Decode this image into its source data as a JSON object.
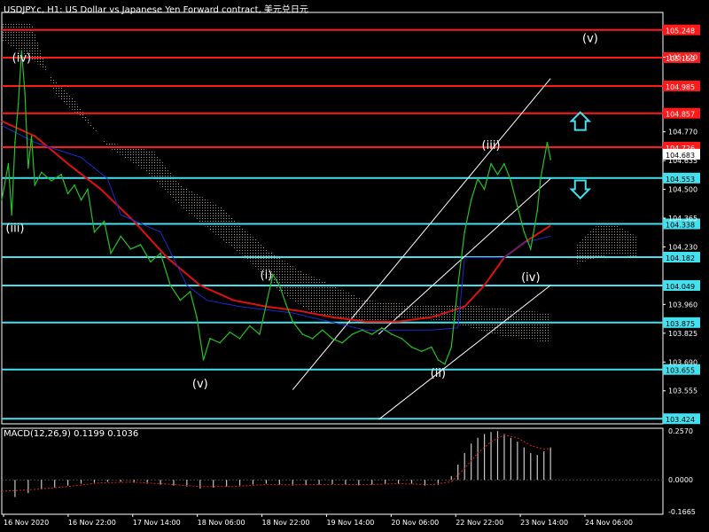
{
  "header": {
    "title": "USDJPY.c, H1:  US Dollar vs Japanese Yen Forward contract, 美元兑日元"
  },
  "macd_header": {
    "label": "MACD(12,26,9) 0.1199 0.1036"
  },
  "colors": {
    "background": "#000000",
    "grid_frame": "#ffffff",
    "red_level": "#ff1a1a",
    "cyan_level": "#44e0ee",
    "price_line": "#22c422",
    "ma_red": "#e01010",
    "ma_blue": "#1a2bd0",
    "cloud_dots": "#d8d0cc",
    "channel": "#ffffff",
    "arrow": "#44e0ee",
    "macd_bars": "#c8c8c8",
    "macd_signal": "#e02020"
  },
  "chart_data": {
    "type": "line",
    "symbol": "USDJPY.c",
    "timeframe": "H1",
    "x_tick_labels": [
      "16 Nov 2020",
      "16 Nov 22:00",
      "17 Nov 14:00",
      "18 Nov 06:00",
      "18 Nov 22:00",
      "19 Nov 14:00",
      "20 Nov 06:00",
      "22 Nov 22:00",
      "23 Nov 14:00",
      "24 Nov 06:00"
    ],
    "ylim": [
      103.4,
      105.33
    ],
    "y_tick_labels": [
      "105.120",
      "104.770",
      "104.635",
      "104.500",
      "104.365",
      "104.230",
      "103.960",
      "103.825",
      "103.690",
      "103.555"
    ],
    "levels": [
      {
        "label": "105.248",
        "value": 105.248,
        "color": "red"
      },
      {
        "label": "105.153",
        "value": 105.118,
        "color": "red"
      },
      {
        "label": "104.985",
        "value": 104.985,
        "color": "red"
      },
      {
        "label": "104.857",
        "value": 104.857,
        "color": "red"
      },
      {
        "label": "104.726",
        "value": 104.698,
        "color": "red"
      },
      {
        "label": "104.553",
        "value": 104.553,
        "color": "cyan"
      },
      {
        "label": "104.338",
        "value": 104.338,
        "color": "cyan"
      },
      {
        "label": "104.182",
        "value": 104.182,
        "color": "cyan"
      },
      {
        "label": "104.049",
        "value": 104.049,
        "color": "cyan"
      },
      {
        "label": "103.875",
        "value": 103.875,
        "color": "cyan"
      },
      {
        "label": "103.655",
        "value": 103.655,
        "color": "cyan"
      },
      {
        "label": "103.424",
        "value": 103.424,
        "color": "cyan"
      }
    ],
    "current_price_label": "104.683",
    "current_price": 104.665,
    "wave_labels": [
      {
        "text": "(iv)",
        "x": 0.03,
        "y": 105.1
      },
      {
        "text": "(iii)",
        "x": 0.02,
        "y": 104.3
      },
      {
        "text": "(v)",
        "x": 0.3,
        "y": 103.57
      },
      {
        "text": "(i)",
        "x": 0.4,
        "y": 104.08
      },
      {
        "text": "(ii)",
        "x": 0.66,
        "y": 103.62
      },
      {
        "text": "(iii)",
        "x": 0.74,
        "y": 104.69
      },
      {
        "text": "(iv)",
        "x": 0.8,
        "y": 104.07
      },
      {
        "text": "(v)",
        "x": 0.89,
        "y": 105.19
      }
    ],
    "arrows": [
      {
        "direction": "up",
        "x": 0.875,
        "y": 104.82
      },
      {
        "direction": "down",
        "x": 0.875,
        "y": 104.5
      }
    ],
    "series": [
      {
        "values": [
          [
            0.0,
            104.45
          ],
          [
            0.01,
            104.62
          ],
          [
            0.015,
            104.38
          ],
          [
            0.02,
            104.72
          ],
          [
            0.025,
            104.9
          ],
          [
            0.03,
            105.15
          ],
          [
            0.035,
            104.95
          ],
          [
            0.04,
            104.6
          ],
          [
            0.045,
            104.75
          ],
          [
            0.05,
            104.52
          ],
          [
            0.06,
            104.58
          ],
          [
            0.075,
            104.54
          ],
          [
            0.09,
            104.57
          ],
          [
            0.1,
            104.48
          ],
          [
            0.11,
            104.52
          ],
          [
            0.12,
            104.45
          ],
          [
            0.13,
            104.5
          ],
          [
            0.14,
            104.3
          ],
          [
            0.155,
            104.35
          ],
          [
            0.165,
            104.2
          ],
          [
            0.18,
            104.28
          ],
          [
            0.195,
            104.22
          ],
          [
            0.21,
            104.24
          ],
          [
            0.225,
            104.16
          ],
          [
            0.24,
            104.2
          ],
          [
            0.255,
            104.05
          ],
          [
            0.27,
            103.98
          ],
          [
            0.285,
            104.02
          ],
          [
            0.295,
            103.9
          ],
          [
            0.305,
            103.7
          ],
          [
            0.315,
            103.8
          ],
          [
            0.33,
            103.78
          ],
          [
            0.345,
            103.83
          ],
          [
            0.36,
            103.8
          ],
          [
            0.375,
            103.86
          ],
          [
            0.39,
            103.82
          ],
          [
            0.4,
            103.96
          ],
          [
            0.41,
            104.1
          ],
          [
            0.42,
            104.05
          ],
          [
            0.43,
            103.96
          ],
          [
            0.44,
            103.88
          ],
          [
            0.455,
            103.82
          ],
          [
            0.47,
            103.8
          ],
          [
            0.485,
            103.84
          ],
          [
            0.5,
            103.8
          ],
          [
            0.515,
            103.78
          ],
          [
            0.53,
            103.82
          ],
          [
            0.545,
            103.84
          ],
          [
            0.56,
            103.82
          ],
          [
            0.575,
            103.85
          ],
          [
            0.59,
            103.82
          ],
          [
            0.605,
            103.8
          ],
          [
            0.62,
            103.76
          ],
          [
            0.635,
            103.74
          ],
          [
            0.65,
            103.76
          ],
          [
            0.66,
            103.7
          ],
          [
            0.67,
            103.68
          ],
          [
            0.68,
            103.76
          ],
          [
            0.69,
            104.05
          ],
          [
            0.7,
            104.3
          ],
          [
            0.71,
            104.45
          ],
          [
            0.72,
            104.55
          ],
          [
            0.73,
            104.5
          ],
          [
            0.74,
            104.62
          ],
          [
            0.75,
            104.57
          ],
          [
            0.76,
            104.62
          ],
          [
            0.77,
            104.54
          ],
          [
            0.78,
            104.42
          ],
          [
            0.79,
            104.3
          ],
          [
            0.8,
            104.22
          ],
          [
            0.81,
            104.4
          ],
          [
            0.815,
            104.55
          ],
          [
            0.825,
            104.72
          ],
          [
            0.83,
            104.64
          ]
        ]
      }
    ],
    "macd": {
      "ylim": [
        -0.18,
        0.27
      ],
      "y_tick_labels": [
        "0.2570",
        "0.0000",
        "-0.1665"
      ],
      "histogram": [
        [
          0.0,
          -0.08
        ],
        [
          0.02,
          -0.09
        ],
        [
          0.04,
          -0.07
        ],
        [
          0.06,
          -0.05
        ],
        [
          0.08,
          -0.04
        ],
        [
          0.1,
          -0.03
        ],
        [
          0.12,
          -0.02
        ],
        [
          0.14,
          -0.015
        ],
        [
          0.16,
          -0.01
        ],
        [
          0.18,
          -0.01
        ],
        [
          0.2,
          -0.015
        ],
        [
          0.22,
          -0.02
        ],
        [
          0.24,
          -0.025
        ],
        [
          0.26,
          -0.03
        ],
        [
          0.28,
          -0.035
        ],
        [
          0.3,
          -0.045
        ],
        [
          0.32,
          -0.04
        ],
        [
          0.34,
          -0.035
        ],
        [
          0.36,
          -0.03
        ],
        [
          0.38,
          -0.025
        ],
        [
          0.4,
          -0.02
        ],
        [
          0.42,
          -0.025
        ],
        [
          0.44,
          -0.03
        ],
        [
          0.46,
          -0.028
        ],
        [
          0.48,
          -0.025
        ],
        [
          0.5,
          -0.022
        ],
        [
          0.52,
          -0.025
        ],
        [
          0.54,
          -0.028
        ],
        [
          0.56,
          -0.025
        ],
        [
          0.58,
          -0.02
        ],
        [
          0.6,
          -0.018
        ],
        [
          0.62,
          -0.02
        ],
        [
          0.64,
          -0.03
        ],
        [
          0.66,
          -0.025
        ],
        [
          0.68,
          0.02
        ],
        [
          0.69,
          0.08
        ],
        [
          0.7,
          0.14
        ],
        [
          0.71,
          0.19
        ],
        [
          0.72,
          0.22
        ],
        [
          0.73,
          0.24
        ],
        [
          0.74,
          0.25
        ],
        [
          0.75,
          0.255
        ],
        [
          0.76,
          0.24
        ],
        [
          0.77,
          0.22
        ],
        [
          0.78,
          0.2
        ],
        [
          0.79,
          0.17
        ],
        [
          0.8,
          0.14
        ],
        [
          0.81,
          0.13
        ],
        [
          0.82,
          0.15
        ],
        [
          0.83,
          0.17
        ]
      ],
      "signal": [
        [
          0.0,
          -0.06
        ],
        [
          0.05,
          -0.05
        ],
        [
          0.1,
          -0.035
        ],
        [
          0.15,
          -0.015
        ],
        [
          0.2,
          -0.012
        ],
        [
          0.25,
          -0.022
        ],
        [
          0.3,
          -0.035
        ],
        [
          0.35,
          -0.035
        ],
        [
          0.4,
          -0.025
        ],
        [
          0.45,
          -0.026
        ],
        [
          0.5,
          -0.024
        ],
        [
          0.55,
          -0.025
        ],
        [
          0.6,
          -0.02
        ],
        [
          0.65,
          -0.025
        ],
        [
          0.68,
          -0.01
        ],
        [
          0.7,
          0.06
        ],
        [
          0.72,
          0.14
        ],
        [
          0.74,
          0.2
        ],
        [
          0.76,
          0.235
        ],
        [
          0.78,
          0.22
        ],
        [
          0.8,
          0.18
        ],
        [
          0.82,
          0.16
        ],
        [
          0.83,
          0.165
        ]
      ]
    }
  }
}
